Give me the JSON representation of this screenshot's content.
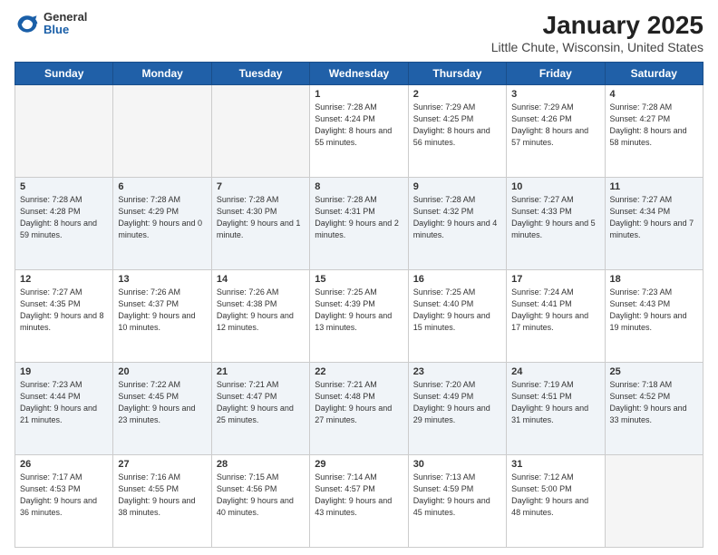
{
  "header": {
    "logo": {
      "general": "General",
      "blue": "Blue"
    },
    "title": "January 2025",
    "location": "Little Chute, Wisconsin, United States"
  },
  "weekdays": [
    "Sunday",
    "Monday",
    "Tuesday",
    "Wednesday",
    "Thursday",
    "Friday",
    "Saturday"
  ],
  "weeks": [
    [
      {
        "day": null
      },
      {
        "day": null
      },
      {
        "day": null
      },
      {
        "day": "1",
        "sunrise": "7:28 AM",
        "sunset": "4:24 PM",
        "daylight": "8 hours and 55 minutes."
      },
      {
        "day": "2",
        "sunrise": "7:29 AM",
        "sunset": "4:25 PM",
        "daylight": "8 hours and 56 minutes."
      },
      {
        "day": "3",
        "sunrise": "7:29 AM",
        "sunset": "4:26 PM",
        "daylight": "8 hours and 57 minutes."
      },
      {
        "day": "4",
        "sunrise": "7:28 AM",
        "sunset": "4:27 PM",
        "daylight": "8 hours and 58 minutes."
      }
    ],
    [
      {
        "day": "5",
        "sunrise": "7:28 AM",
        "sunset": "4:28 PM",
        "daylight": "8 hours and 59 minutes."
      },
      {
        "day": "6",
        "sunrise": "7:28 AM",
        "sunset": "4:29 PM",
        "daylight": "9 hours and 0 minutes."
      },
      {
        "day": "7",
        "sunrise": "7:28 AM",
        "sunset": "4:30 PM",
        "daylight": "9 hours and 1 minute."
      },
      {
        "day": "8",
        "sunrise": "7:28 AM",
        "sunset": "4:31 PM",
        "daylight": "9 hours and 2 minutes."
      },
      {
        "day": "9",
        "sunrise": "7:28 AM",
        "sunset": "4:32 PM",
        "daylight": "9 hours and 4 minutes."
      },
      {
        "day": "10",
        "sunrise": "7:27 AM",
        "sunset": "4:33 PM",
        "daylight": "9 hours and 5 minutes."
      },
      {
        "day": "11",
        "sunrise": "7:27 AM",
        "sunset": "4:34 PM",
        "daylight": "9 hours and 7 minutes."
      }
    ],
    [
      {
        "day": "12",
        "sunrise": "7:27 AM",
        "sunset": "4:35 PM",
        "daylight": "9 hours and 8 minutes."
      },
      {
        "day": "13",
        "sunrise": "7:26 AM",
        "sunset": "4:37 PM",
        "daylight": "9 hours and 10 minutes."
      },
      {
        "day": "14",
        "sunrise": "7:26 AM",
        "sunset": "4:38 PM",
        "daylight": "9 hours and 12 minutes."
      },
      {
        "day": "15",
        "sunrise": "7:25 AM",
        "sunset": "4:39 PM",
        "daylight": "9 hours and 13 minutes."
      },
      {
        "day": "16",
        "sunrise": "7:25 AM",
        "sunset": "4:40 PM",
        "daylight": "9 hours and 15 minutes."
      },
      {
        "day": "17",
        "sunrise": "7:24 AM",
        "sunset": "4:41 PM",
        "daylight": "9 hours and 17 minutes."
      },
      {
        "day": "18",
        "sunrise": "7:23 AM",
        "sunset": "4:43 PM",
        "daylight": "9 hours and 19 minutes."
      }
    ],
    [
      {
        "day": "19",
        "sunrise": "7:23 AM",
        "sunset": "4:44 PM",
        "daylight": "9 hours and 21 minutes."
      },
      {
        "day": "20",
        "sunrise": "7:22 AM",
        "sunset": "4:45 PM",
        "daylight": "9 hours and 23 minutes."
      },
      {
        "day": "21",
        "sunrise": "7:21 AM",
        "sunset": "4:47 PM",
        "daylight": "9 hours and 25 minutes."
      },
      {
        "day": "22",
        "sunrise": "7:21 AM",
        "sunset": "4:48 PM",
        "daylight": "9 hours and 27 minutes."
      },
      {
        "day": "23",
        "sunrise": "7:20 AM",
        "sunset": "4:49 PM",
        "daylight": "9 hours and 29 minutes."
      },
      {
        "day": "24",
        "sunrise": "7:19 AM",
        "sunset": "4:51 PM",
        "daylight": "9 hours and 31 minutes."
      },
      {
        "day": "25",
        "sunrise": "7:18 AM",
        "sunset": "4:52 PM",
        "daylight": "9 hours and 33 minutes."
      }
    ],
    [
      {
        "day": "26",
        "sunrise": "7:17 AM",
        "sunset": "4:53 PM",
        "daylight": "9 hours and 36 minutes."
      },
      {
        "day": "27",
        "sunrise": "7:16 AM",
        "sunset": "4:55 PM",
        "daylight": "9 hours and 38 minutes."
      },
      {
        "day": "28",
        "sunrise": "7:15 AM",
        "sunset": "4:56 PM",
        "daylight": "9 hours and 40 minutes."
      },
      {
        "day": "29",
        "sunrise": "7:14 AM",
        "sunset": "4:57 PM",
        "daylight": "9 hours and 43 minutes."
      },
      {
        "day": "30",
        "sunrise": "7:13 AM",
        "sunset": "4:59 PM",
        "daylight": "9 hours and 45 minutes."
      },
      {
        "day": "31",
        "sunrise": "7:12 AM",
        "sunset": "5:00 PM",
        "daylight": "9 hours and 48 minutes."
      },
      {
        "day": null
      }
    ]
  ]
}
